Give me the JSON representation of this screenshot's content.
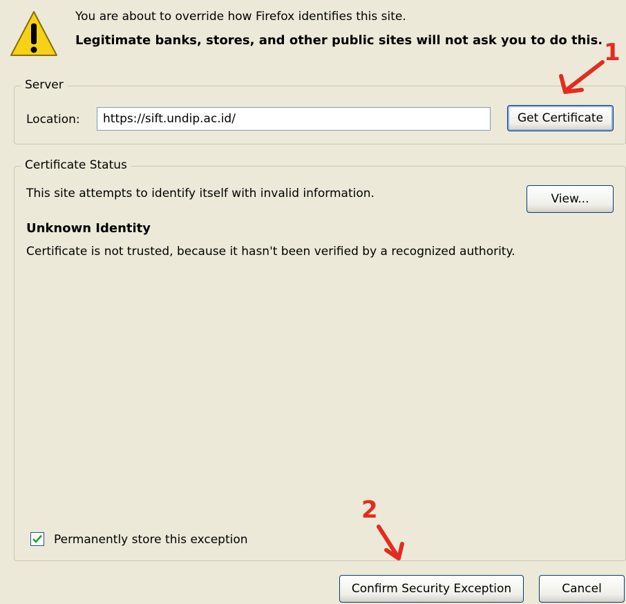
{
  "header": {
    "warning_line": "You are about to override how Firefox identifies this site.",
    "warning_bold": "Legitimate banks, stores, and other public sites will not ask you to do this."
  },
  "server": {
    "legend": "Server",
    "location_label": "Location:",
    "location_value": "https://sift.undip.ac.id/",
    "get_certificate_label": "Get Certificate"
  },
  "certificate_status": {
    "legend": "Certificate Status",
    "summary": "This site attempts to identify itself with invalid information.",
    "view_label": "View...",
    "identity_heading": "Unknown Identity",
    "identity_detail": "Certificate is not trusted, because it hasn't been verified by a recognized authority.",
    "permanent_label": "Permanently store this exception",
    "permanent_checked": true
  },
  "footer": {
    "confirm_label": "Confirm Security Exception",
    "cancel_label": "Cancel"
  },
  "annotations": {
    "step1": "1",
    "step2": "2"
  },
  "colors": {
    "dialog_bg": "#ece9d8",
    "annotation_red": "#e52b1f",
    "warning_yellow": "#f7d117"
  }
}
